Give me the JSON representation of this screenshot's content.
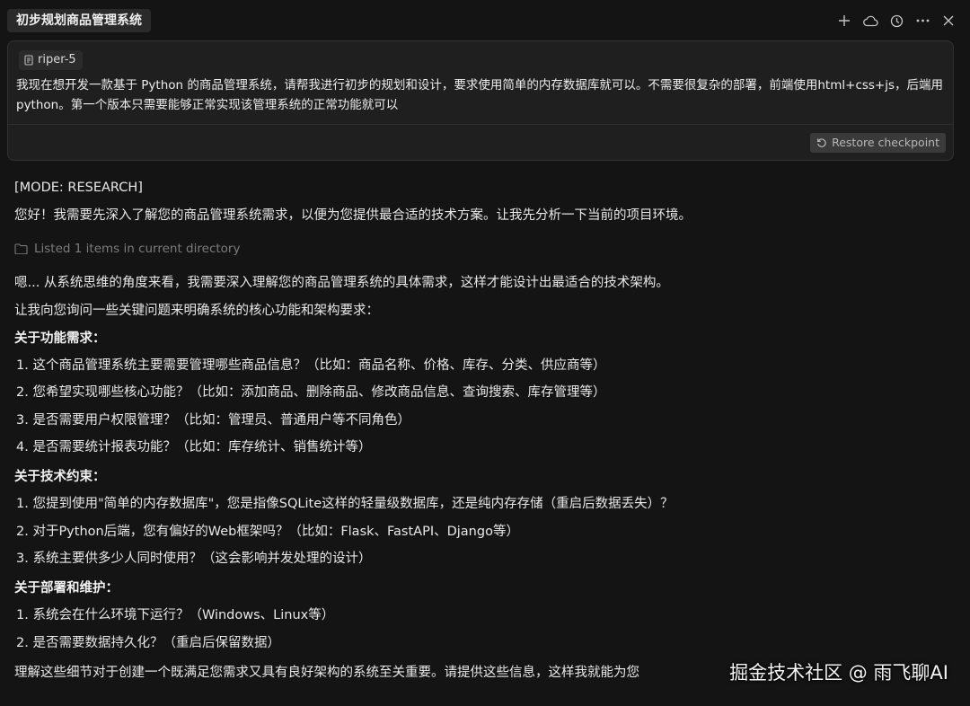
{
  "header": {
    "title": "初步规划商品管理系统",
    "actions": [
      {
        "name": "new-chat",
        "icon": "plus-icon"
      },
      {
        "name": "cloud",
        "icon": "cloud-icon"
      },
      {
        "name": "history",
        "icon": "history-icon"
      },
      {
        "name": "more",
        "icon": "ellipsis-icon"
      },
      {
        "name": "close",
        "icon": "close-icon"
      }
    ]
  },
  "user_message": {
    "tag": "riper-5",
    "text": "我现在想开发一款基于 Python 的商品管理系统，请帮我进行初步的规划和设计，要求使用简单的内存数据库就可以。不需要很复杂的部署，前端使用html+css+js，后端用python。第一个版本只需要能够正常实现该管理系统的正常功能就可以",
    "restore_label": "Restore checkpoint"
  },
  "assistant": {
    "mode": "[MODE: RESEARCH]",
    "intro": "您好！我需要先深入了解您的商品管理系统需求，以便为您提供最合适的技术方案。让我先分析一下当前的项目环境。",
    "tool_status": "Listed 1 items in current directory",
    "thinking": "嗯... 从系统思维的角度来看，我需要深入理解您的商品管理系统的具体需求，这样才能设计出最适合的技术架构。",
    "ask_intro": "让我向您询问一些关键问题来明确系统的核心功能和架构要求：",
    "sections": [
      {
        "heading": "关于功能需求：",
        "items": [
          "1. 这个商品管理系统主要需要管理哪些商品信息？（比如：商品名称、价格、库存、分类、供应商等）",
          "2. 您希望实现哪些核心功能？（比如：添加商品、删除商品、修改商品信息、查询搜索、库存管理等）",
          "3. 是否需要用户权限管理？（比如：管理员、普通用户等不同角色）",
          "4. 是否需要统计报表功能？（比如：库存统计、销售统计等）"
        ]
      },
      {
        "heading": "关于技术约束：",
        "items": [
          "1. 您提到使用\"简单的内存数据库\"，您是指像SQLite这样的轻量级数据库，还是纯内存存储（重启后数据丢失）？",
          "2. 对于Python后端，您有偏好的Web框架吗？（比如：Flask、FastAPI、Django等）",
          "3. 系统主要供多少人同时使用？（这会影响并发处理的设计）"
        ]
      },
      {
        "heading": "关于部署和维护：",
        "items": [
          "1. 系统会在什么环境下运行？（Windows、Linux等）",
          "2. 是否需要数据持久化？（重启后保留数据）"
        ]
      }
    ],
    "closing": "理解这些细节对于创建一个既满足您需求又具有良好架构的系统至关重要。请提供这些信息，这样我就能为您"
  },
  "watermark": "掘金技术社区 @ 雨飞聊AI"
}
